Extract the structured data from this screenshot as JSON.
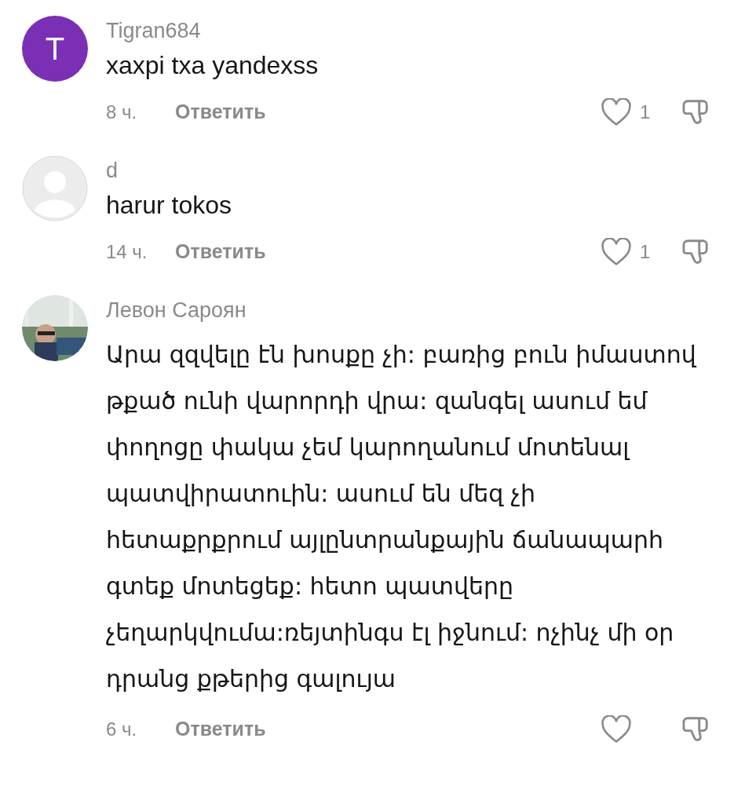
{
  "comments": [
    {
      "avatar": {
        "kind": "letter",
        "letter": "T",
        "color": "#7b2fb5"
      },
      "username": "Tigran684",
      "text": "xaxpi txa yandexss",
      "time": "8 ч.",
      "reply": "Ответить",
      "likes": "1",
      "liked": false
    },
    {
      "avatar": {
        "kind": "default"
      },
      "username": "d",
      "text": "harur tokos",
      "time": "14 ч.",
      "reply": "Ответить",
      "likes": "1",
      "liked": false
    },
    {
      "username": "Левон Сароян",
      "text": "Արա զզվելը էն խոսքը չի: բառից բուն իմաստով թքած ունի վարորդի վրա: զանգել ասում եմ փողոցը փակա չեմ կարողանում մոտենալ պատվիրատուին: ասում են մեզ չի հետաքրքրում այլընտրանքային ճանապարհ գտեք մոտեցեք: հետո պատվերը չեղարկվումա:ռեյտինգս էլ իջնում: ոչինչ մի օր դրանց քթերից գալույա",
      "time": "6 ч.",
      "reply": "Ответить",
      "liked": false
    }
  ]
}
